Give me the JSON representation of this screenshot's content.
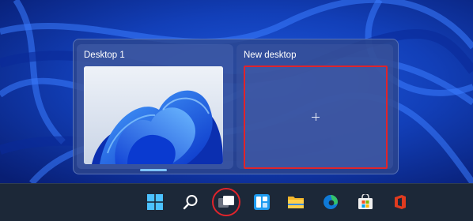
{
  "task_view": {
    "desktops": [
      {
        "label": "Desktop 1",
        "active": true
      },
      {
        "label": "New desktop",
        "active": false
      }
    ]
  },
  "taskbar": {
    "icons": [
      "windows-start-icon",
      "search-icon",
      "task-view-icon",
      "widgets-icon",
      "file-explorer-icon",
      "edge-icon",
      "microsoft-store-icon",
      "office-icon"
    ],
    "highlighted": "task-view-icon"
  },
  "colors": {
    "highlight": "#e0242b",
    "active_indicator": "#7cc3ff",
    "taskbar": "#1c2838"
  }
}
